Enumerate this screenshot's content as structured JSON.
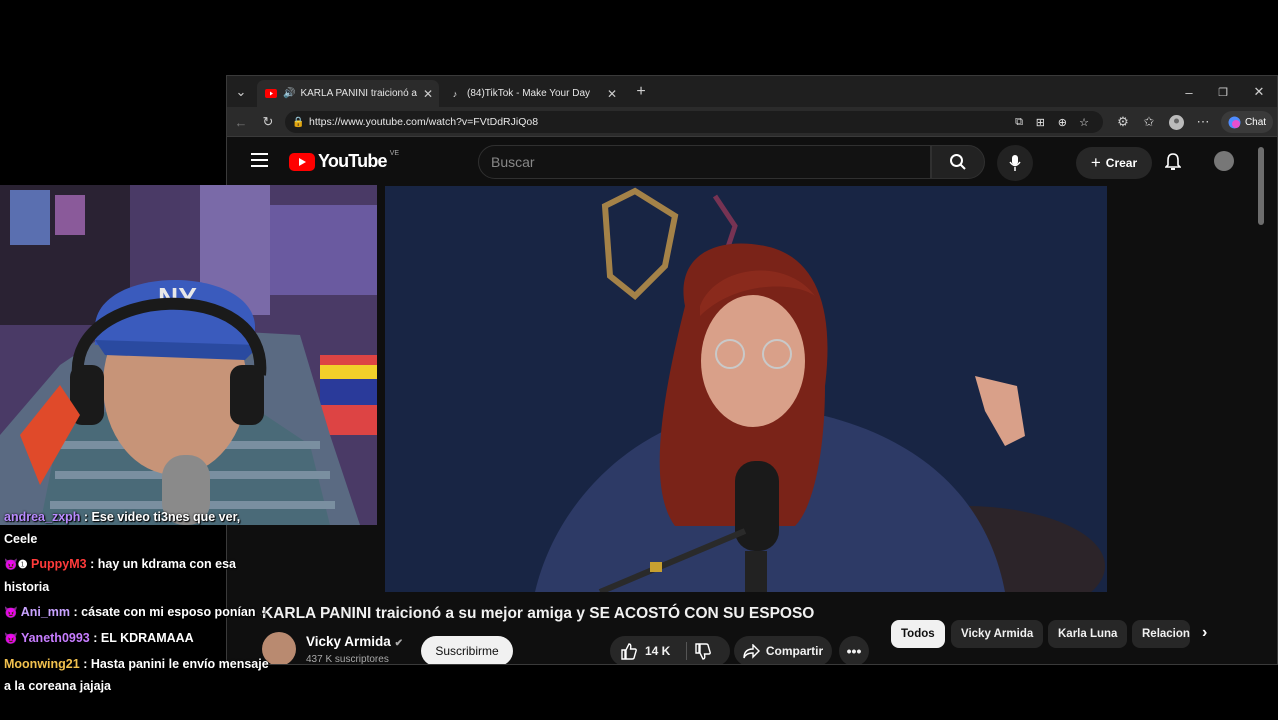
{
  "browser": {
    "tabs": [
      {
        "title": "KARLA PANINI traicionó a su me",
        "active": true,
        "favicon": "youtube-icon"
      },
      {
        "title": "(84)TikTok - Make Your Day",
        "active": false,
        "favicon": "tiktok-icon"
      }
    ],
    "url": "https://www.youtube.com/watch?v=FVtDdRJiQo8",
    "chat_button": "Chat"
  },
  "youtube": {
    "logo_text": "YouTube",
    "country_code": "VE",
    "search_placeholder": "Buscar",
    "create_label": "Crear",
    "video_title": "KARLA PANINI traicionó a su mejor amiga y SE ACOSTÓ CON SU ESPOSO",
    "channel_name": "Vicky Armida",
    "subscribers": "437 K suscriptores",
    "subscribe_label": "Suscribirme",
    "likes": "14 K",
    "share_label": "Compartir",
    "chips": [
      "Todos",
      "Vicky Armida",
      "Karla Luna",
      "Relacion"
    ]
  },
  "chat": [
    {
      "user": "andrea_zxph",
      "color": "#b98cff",
      "text": ": Ese video ti3nes que ver, Ceele",
      "badges": ""
    },
    {
      "user": "PuppyM3",
      "color": "#ff3b3b",
      "text": ": hay un kdrama con esa historia",
      "badges": "😈❶"
    },
    {
      "user": "Ani_mm",
      "color": "#c9a3ff",
      "text": ": cásate con mi esposo ponían",
      "badges": "😈"
    },
    {
      "user": "Yaneth0993",
      "color": "#c77dff",
      "text": ": EL KDRAMAAA",
      "badges": "😈"
    },
    {
      "user": "Moonwing21",
      "color": "#f2c14e",
      "text": ": Hasta panini le envío mensaje a la coreana jajaja",
      "badges": ""
    }
  ]
}
